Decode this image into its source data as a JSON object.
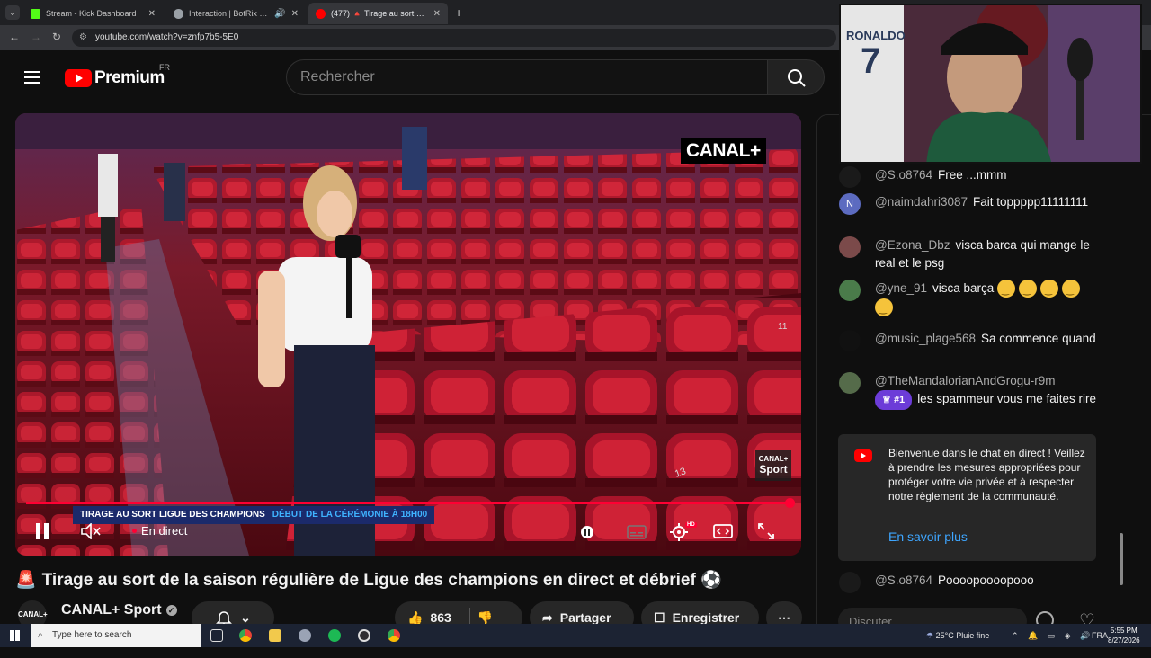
{
  "browser": {
    "tabs": [
      {
        "label": "Stream - Kick Dashboard",
        "favicon_color": "#53fc18"
      },
      {
        "label": "Interaction | BotRix — Clou",
        "favicon_color": "#9aa0a6"
      },
      {
        "label": "(477) 🔺 Tirage au sort de la sa",
        "favicon_color": "#ff0000"
      }
    ],
    "url": "youtube.com/watch?v=znfp7b5-5E0"
  },
  "youtube": {
    "brand": "Premium",
    "country": "FR",
    "search_placeholder": "Rechercher"
  },
  "player": {
    "broadcaster_logo": "CANAL+",
    "sport_bug_top": "CANAL+",
    "sport_bug_bottom": "Sport",
    "lower_third_left": "TIRAGE AU SORT LIGUE DES CHAMPIONS",
    "lower_third_right": "DÉBUT DE LA CÉRÉMONIE À 18H00",
    "live_label": "En direct",
    "hd_badge": "HD",
    "progress": 1.0,
    "seat_number_1": "13",
    "seat_number_2": "11"
  },
  "video": {
    "title": "Tirage au sort de la saison régulière de Ligue des champions en direct et débrief",
    "title_prefix_icon": "🚨",
    "title_suffix_icon": "⚽",
    "channel": "CANAL+ Sport",
    "channel_avatar": "CANAL+ Sport",
    "likes": "863",
    "share_label": "Partager",
    "save_label": "Enregistrer"
  },
  "chat": {
    "messages": [
      {
        "author": "@S.o8764",
        "text": "Free ...mmm",
        "avatar_color": "#1a1a1a",
        "avatar_letter": ""
      },
      {
        "author": "@naimdahri3087",
        "text": "Fait toppppp11111111",
        "avatar_color": "#5c6bc0",
        "avatar_letter": "N"
      },
      {
        "author": "@Ezona_Dbz",
        "text": "visca barca qui mange le real et le psg",
        "avatar_color": "#7b4a4a",
        "avatar_letter": ""
      },
      {
        "author": "@yne_91",
        "text": "visca barça",
        "avatar_color": "#4a7b4a",
        "avatar_letter": ""
      },
      {
        "author": "@music_plage568",
        "text": "Sa commence quand",
        "avatar_color": "#111111",
        "avatar_letter": ""
      },
      {
        "author": "@TheMandalorianAndGrogu-r9m",
        "badge": "#1",
        "text": "les spammeur vous me faites rire",
        "avatar_color": "#556b4a",
        "avatar_letter": ""
      },
      {
        "author": "@S.o8764",
        "text": "Poooopoooopooo",
        "avatar_color": "#1a1a1a",
        "avatar_letter": ""
      }
    ],
    "welcome_text": "Bienvenue dans le chat en direct ! Veillez à prendre les mesures appropriées pour protéger votre vie privée et à respecter notre règlement de la communauté.",
    "welcome_link": "En savoir plus",
    "input_placeholder": "Discuter..."
  },
  "webcam": {
    "jersey_text": "RONALDO",
    "jersey_number": "7"
  },
  "taskbar": {
    "search_placeholder": "Type here to search",
    "weather": "25°C  Pluie fine",
    "language": "FRA",
    "time": "5:55 PM",
    "date": "8/27/2026"
  }
}
